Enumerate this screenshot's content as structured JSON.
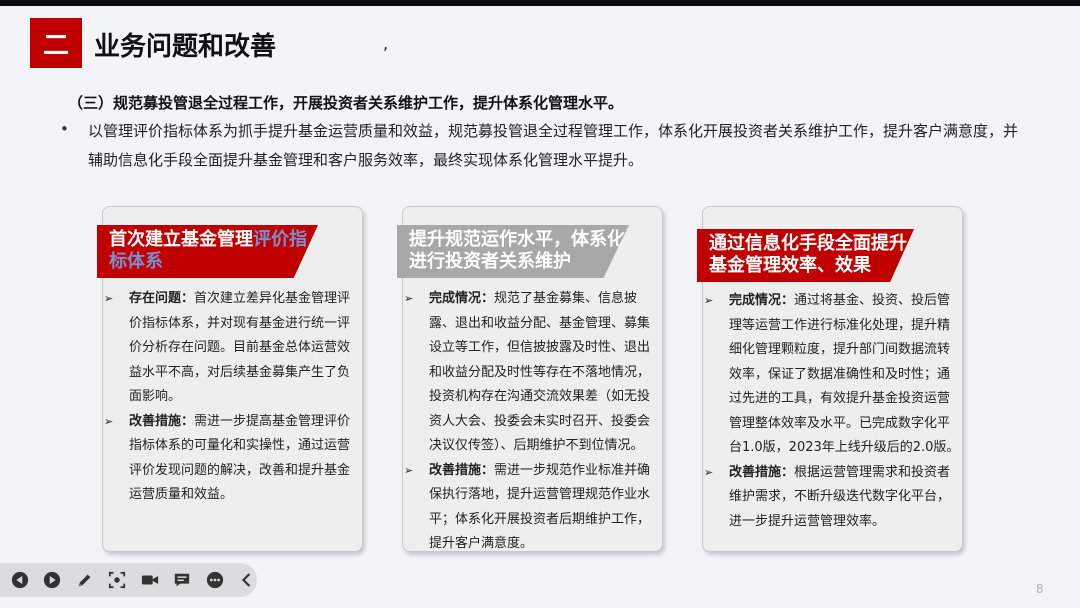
{
  "header": {
    "section_number": "二",
    "title": "业务问题和改善",
    "stray_mark": ","
  },
  "subheading": "（三）规范募投管退全过程工作，开展投资者关系维护工作，提升体系化管理水平。",
  "intro": {
    "bullet": "•",
    "text": "以管理评价指标体系为抓手提升基金运营质量和效益，规范募投管退全过程管理工作，体系化开展投资者关系维护工作，提升客户满意度，并辅助信息化手段全面提升基金管理和客户服务效率，最终实现体系化管理水平提升。"
  },
  "cards": [
    {
      "title_main": "首次建立基金管理",
      "title_hl": "评价指标体系",
      "items": [
        {
          "label": "存在问题：",
          "text": "首次建立差异化基金管理评价指标体系，并对现有基金进行统一评价分析存在问题。目前基金总体运营效益水平不高，对后续基金募集产生了负面影响。"
        },
        {
          "label": "改善措施：",
          "text": "需进一步提高基金管理评价指标体系的可量化和实操性，通过运营评价发现问题的解决，改善和提升基金运营质量和效益。"
        }
      ]
    },
    {
      "title_main": "提升规范运作水平，体系化进行投资者关系维护",
      "items": [
        {
          "label": "完成情况：",
          "text": "规范了基金募集、信息披露、退出和收益分配、基金管理、募集设立等工作，但信披披露及时性、退出和收益分配及时性等存在不落地情况，投资机构存在沟通交流效果差（如无投资人大会、投委会未实时召开、投委会决议仅传签）、后期维护不到位情况。"
        },
        {
          "label": "改善措施：",
          "text": "需进一步规范作业标准并确保执行落地，提升运营管理规范作业水平；体系化开展投资者后期维护工作，提升客户满意度。"
        }
      ]
    },
    {
      "title_main": "通过信息化手段全面提升基金管理效率、效果",
      "items": [
        {
          "label": "完成情况：",
          "text": "通过将基金、投资、投后管理等运营工作进行标准化处理，提升精细化管理颗粒度，提升部门间数据流转效率，保证了数据准确性和及时性；通过先进的工具，有效提升基金投资运营管理整体效率及水平。已完成数字化平台1.0版，2023年上线升级后的2.0版。"
        },
        {
          "label": "改善措施：",
          "text": "根据运营管理需求和投资者维护需求，不断升级迭代数字化平台，进一步提升运营管理效率。"
        }
      ]
    }
  ],
  "arrow_glyph": "➢",
  "toolbar": {
    "icons": [
      "prev-icon",
      "next-icon",
      "pen-icon",
      "screenshot-icon",
      "camera-icon",
      "comment-icon",
      "more-icon",
      "collapse-icon"
    ]
  },
  "page_number": "8",
  "colors": {
    "accent_red": "#c00000",
    "banner_gray": "#a8a8a8",
    "highlight_blue": "#7a8fcf"
  }
}
